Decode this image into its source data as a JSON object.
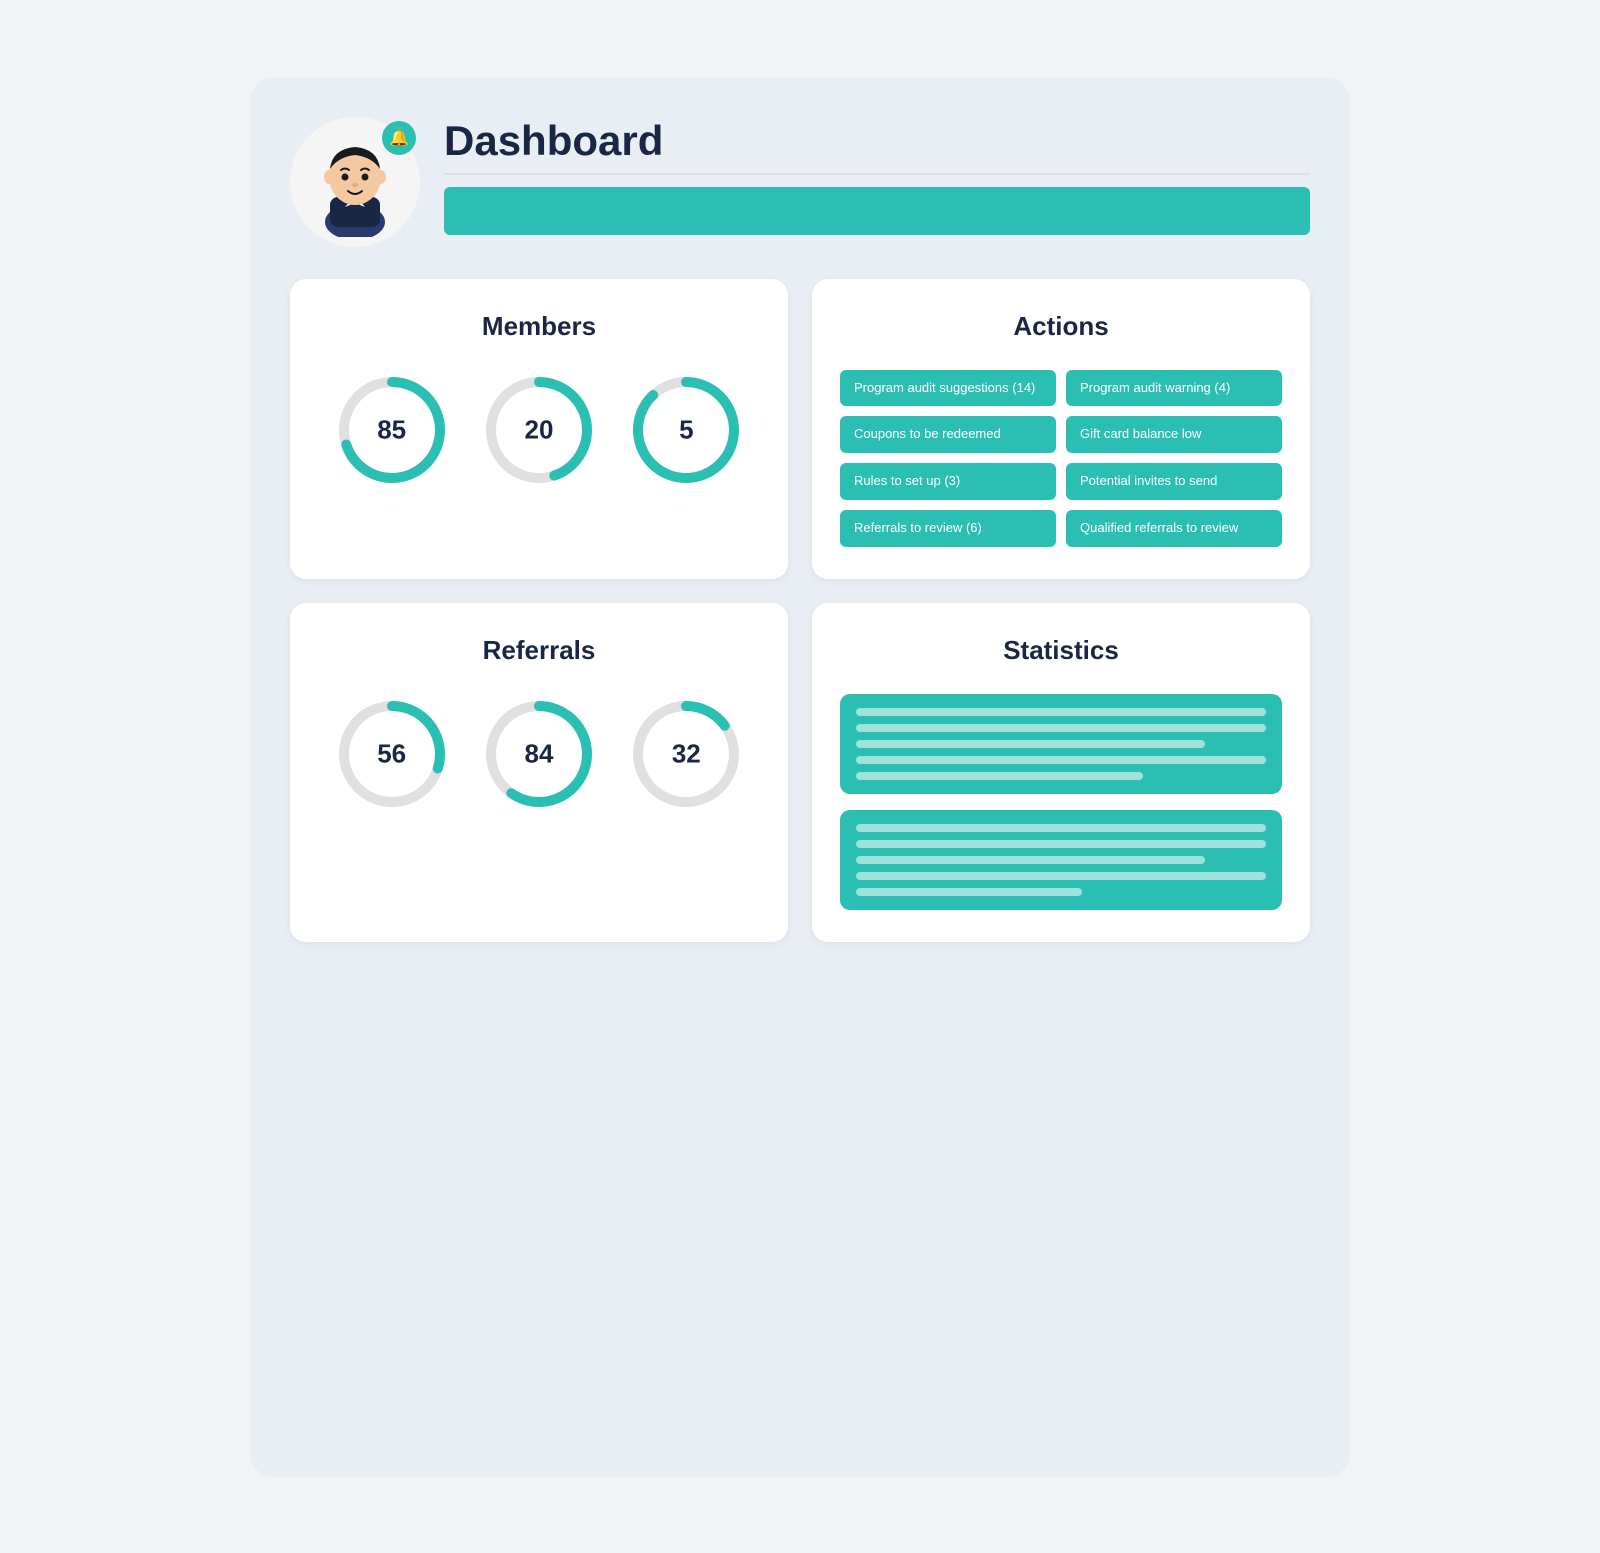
{
  "header": {
    "title": "Dashboard",
    "notification_icon": "🔔"
  },
  "members": {
    "title": "Members",
    "charts": [
      {
        "value": 85,
        "percent": 70,
        "color": "#2bbfb3"
      },
      {
        "value": 20,
        "percent": 45,
        "color": "#2bbfb3"
      },
      {
        "value": 5,
        "percent": 88,
        "color": "#2bbfb3"
      }
    ]
  },
  "referrals": {
    "title": "Referrals",
    "charts": [
      {
        "value": 56,
        "percent": 30,
        "color": "#2bbfb3"
      },
      {
        "value": 84,
        "percent": 60,
        "color": "#2bbfb3"
      },
      {
        "value": 32,
        "percent": 15,
        "color": "#2bbfb3"
      }
    ]
  },
  "actions": {
    "title": "Actions",
    "buttons": [
      {
        "label": "Program audit suggestions (14)"
      },
      {
        "label": "Program audit warning (4)"
      },
      {
        "label": "Coupons to be redeemed"
      },
      {
        "label": "Gift card balance low"
      },
      {
        "label": "Rules to set up (3)"
      },
      {
        "label": "Potential invites to send"
      },
      {
        "label": "Referrals to review (6)"
      },
      {
        "label": "Qualified referrals to review"
      }
    ]
  },
  "statistics": {
    "title": "Statistics"
  }
}
